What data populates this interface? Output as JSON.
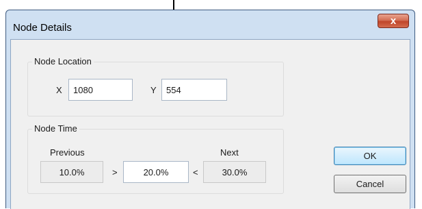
{
  "window": {
    "title": "Node Details",
    "close_glyph": "x"
  },
  "location_group": {
    "label": "Node Location",
    "x_label": "X",
    "x_value": "1080",
    "y_label": "Y",
    "y_value": "554"
  },
  "time_group": {
    "label": "Node Time",
    "previous_label": "Previous",
    "next_label": "Next",
    "previous_value": "10.0%",
    "current_value": "20.0%",
    "next_value": "30.0%",
    "gt_symbol": ">",
    "lt_symbol": "<"
  },
  "buttons": {
    "ok": "OK",
    "cancel": "Cancel"
  },
  "icons": {
    "annotation": "arrow-down-icon",
    "close": "close-icon"
  }
}
